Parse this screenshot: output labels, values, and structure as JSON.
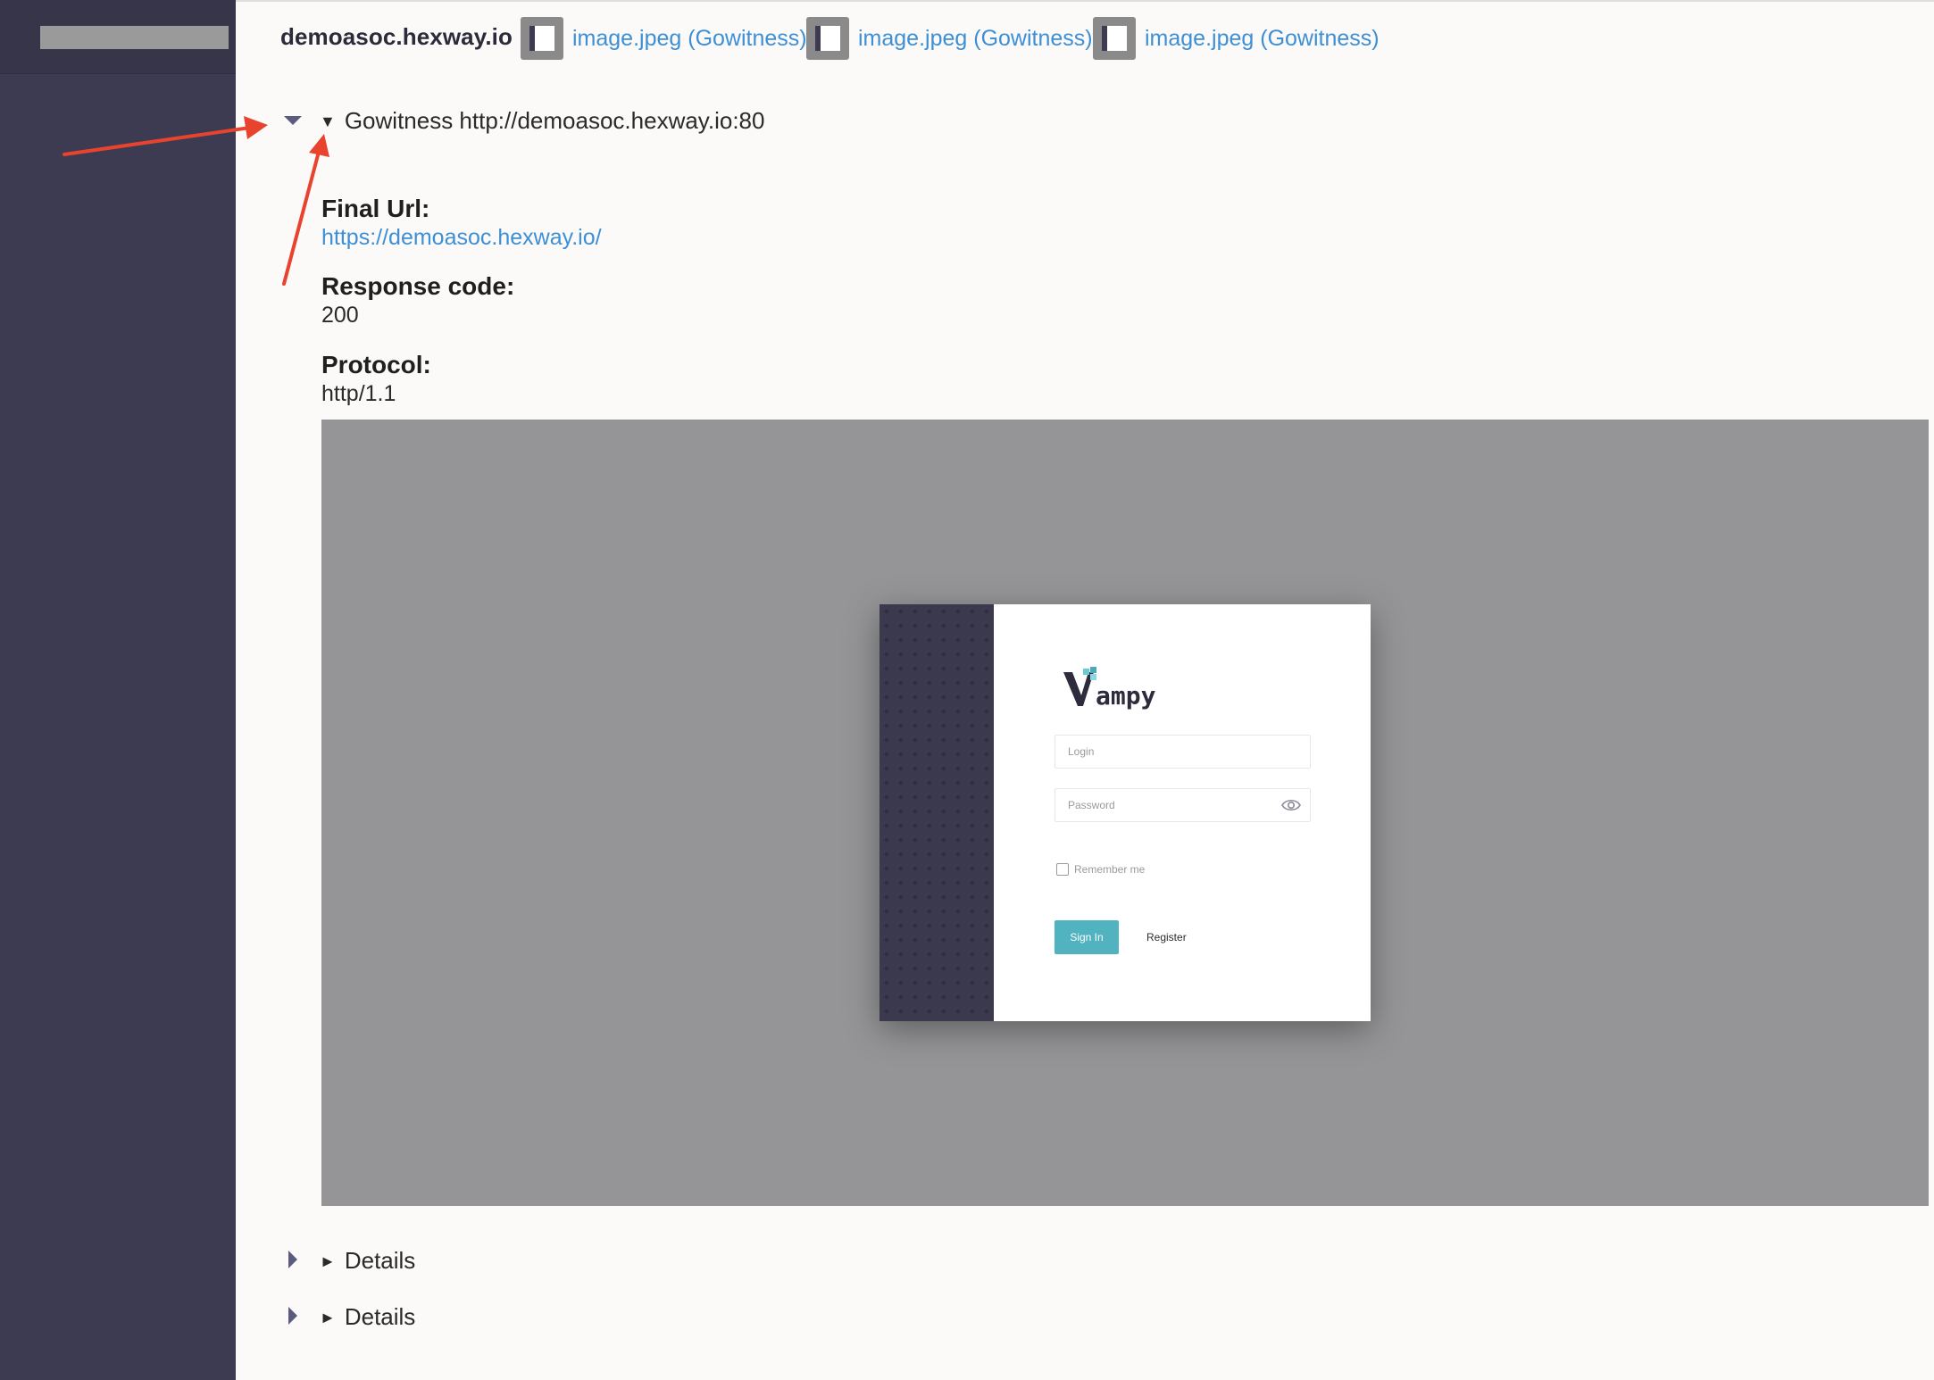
{
  "sidebar": {
    "redacted_label": ""
  },
  "header": {
    "host_title": "demoasoc.hexway.io",
    "attachments": [
      {
        "label": "image.jpeg (Gowitness)",
        "icon": "image-thumbnail-icon"
      },
      {
        "label": "image.jpeg (Gowitness)",
        "icon": "image-thumbnail-icon"
      },
      {
        "label": "image.jpeg (Gowitness)",
        "icon": "image-thumbnail-icon"
      }
    ]
  },
  "gowitness": {
    "expanded_caret_icon": "caret-down-icon",
    "summary_marker": "▼",
    "summary_text": "Gowitness http://demoasoc.hexway.io:80",
    "fields": [
      {
        "label": "Final Url:",
        "value": "https://demoasoc.hexway.io/",
        "is_link": true
      },
      {
        "label": "Response code:",
        "value": "200",
        "is_link": false
      },
      {
        "label": "Protocol:",
        "value": "http/1.1",
        "is_link": false
      }
    ],
    "screenshot": {
      "login_placeholder": "Login",
      "password_placeholder": "Password",
      "remember_label": "Remember me",
      "remember_checked": false,
      "signin_label": "Sign In",
      "register_label": "Register",
      "brand_text": "ampy",
      "accent_color": "#50b3bf"
    }
  },
  "details": [
    {
      "marker": "►",
      "label": "Details",
      "caret_icon": "caret-right-icon"
    },
    {
      "marker": "►",
      "label": "Details",
      "caret_icon": "caret-right-icon"
    }
  ],
  "annotations": {
    "arrow_color": "#e8432f",
    "arrow_icon": "red-arrow-icon"
  },
  "colors": {
    "sidebar": "#3c3b52",
    "link": "#3d8fd6",
    "background": "#fbfaf8"
  }
}
